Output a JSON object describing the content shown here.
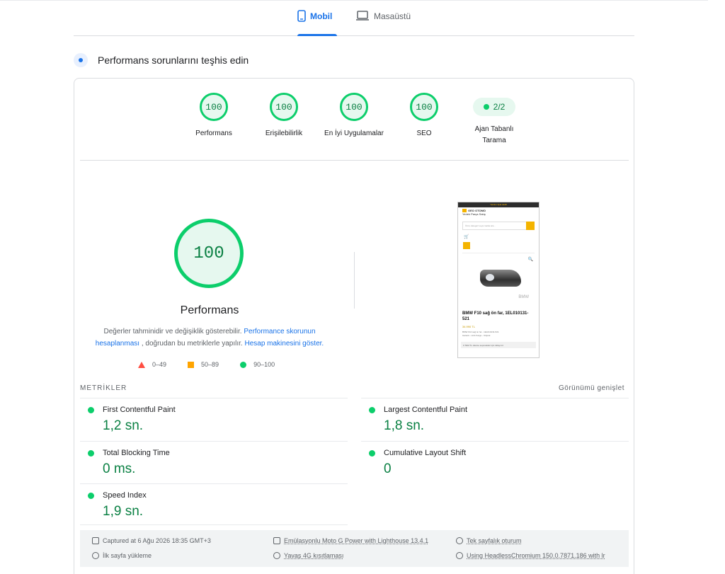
{
  "tabs": [
    {
      "label": "Mobil",
      "icon": "phone-icon",
      "active": true
    },
    {
      "label": "Masaüstü",
      "icon": "laptop-icon",
      "active": false
    }
  ],
  "section": {
    "title": "Performans sorunlarını teşhis edin"
  },
  "categories": [
    {
      "score": "100",
      "label": "Performans"
    },
    {
      "score": "100",
      "label": "Erişilebilirlik"
    },
    {
      "score": "100",
      "label": "En İyi Uygulamalar"
    },
    {
      "score": "100",
      "label": "SEO"
    }
  ],
  "agent": {
    "value": "2/2",
    "label_line1": "Ajan Tabanlı",
    "label_line2": "Tarama"
  },
  "perf": {
    "score": "100",
    "title": "Performans",
    "note_part1": "Değerler tahminidir ve değişiklik gösterebilir. ",
    "link_calc": "Performance skorunun hesaplanması",
    "note_part2": " , doğrudan bu metriklerle yapılır. ",
    "link_calculator": "Hesap makinesini göster."
  },
  "legend": {
    "bad": "0–49",
    "avg": "50–89",
    "good": "90–100"
  },
  "screenshot": {
    "banner": "Yazılım fiyat teklifi",
    "brand": "GEO OTOMO",
    "brand_sub": "Yedek Parça Satış",
    "search_placeholder": "Ürün, kategori veya marka ara...",
    "brand_mark": "BMW",
    "product_name": "BMW F10 sağ ön far, 1EL010131-521",
    "price": "34.990 TL",
    "small1": "BMW F10 sağ ön far - 1EL010131-521",
    "small2": "Garanti - Hızlı Kargo - Orijinal",
    "footer": "9 TEM TL ödeme seçenekleri için tıklayınız"
  },
  "colors": {
    "good": "#0cce6b",
    "good_text": "#0a8043",
    "accent": "#1a73e8",
    "avg": "#ffa400",
    "bad": "#ff4e42"
  },
  "metrics": {
    "heading": "METRİKLER",
    "expand": "Görünümü genişlet",
    "fcp": {
      "name": "First Contentful Paint",
      "value": "1,2 sn."
    },
    "lcp": {
      "name": "Largest Contentful Paint",
      "value": "1,8 sn."
    },
    "tbt": {
      "name": "Total Blocking Time",
      "value": "0 ms."
    },
    "cls": {
      "name": "Cumulative Layout Shift",
      "value": "0"
    },
    "si": {
      "name": "Speed Index",
      "value": "1,9 sn."
    }
  },
  "runtime": {
    "captured": "Captured at 6 Ağu 2026 18:35 GMT+3",
    "load": "İlk sayfa yükleme",
    "emulation": "Emülasyonlu Moto G Power with Lighthouse 13.4.1",
    "throttling": "Yavaş 4G kısıtlaması",
    "session": "Tek sayfalık oturum",
    "browser": "Using HeadlessChromium 150.0.7871.186 with lr"
  }
}
